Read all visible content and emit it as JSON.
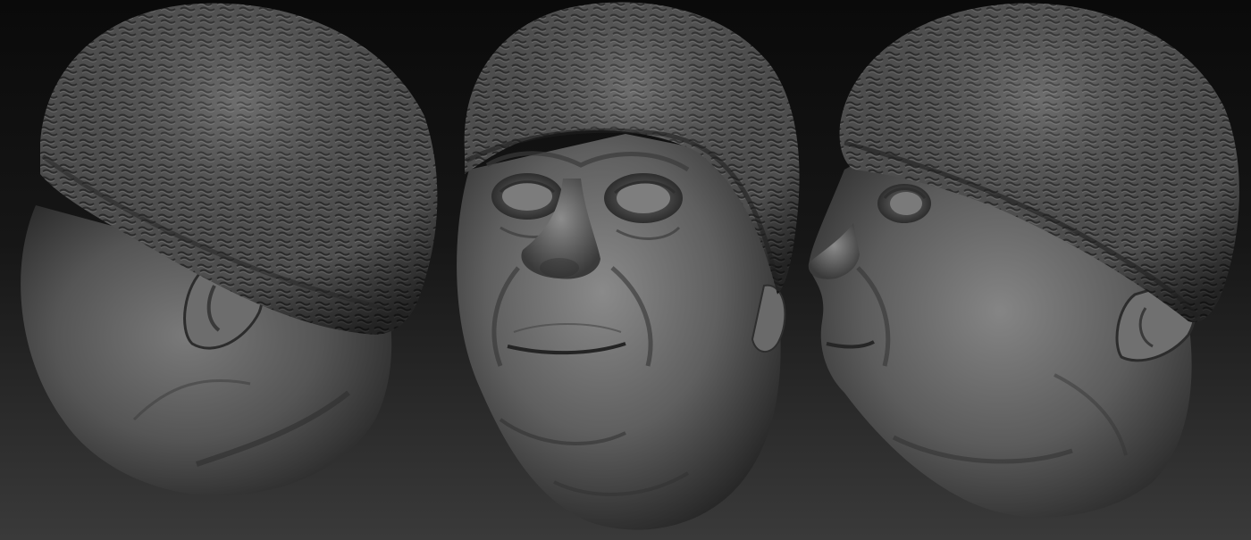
{
  "scene": {
    "background_top_color": "#0a0a0a",
    "background_bottom_color": "#3a3a3a",
    "material_color": "#6a6a6a",
    "views": [
      {
        "name": "back-three-quarter-view"
      },
      {
        "name": "front-view"
      },
      {
        "name": "side-three-quarter-view"
      }
    ]
  }
}
